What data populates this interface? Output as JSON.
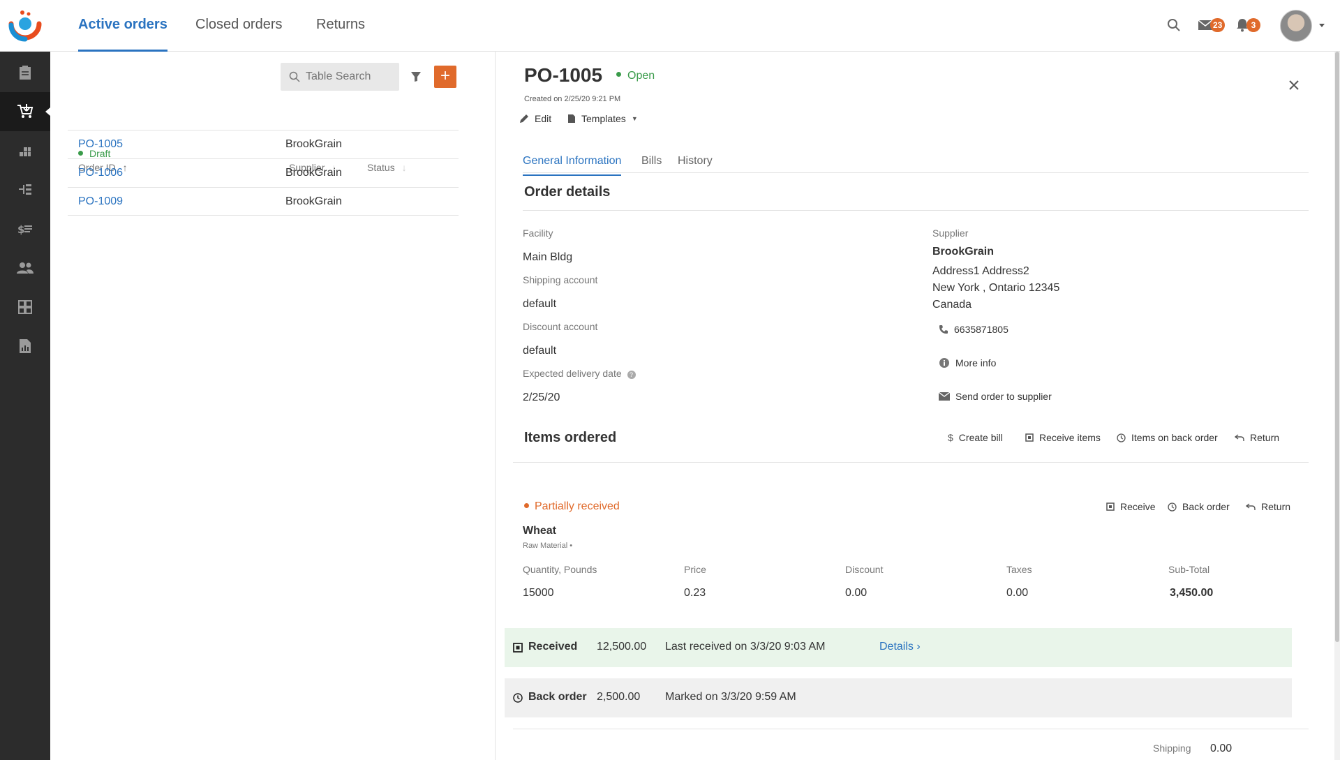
{
  "nav": {
    "tabs": [
      {
        "label": "Active orders"
      },
      {
        "label": "Closed orders"
      },
      {
        "label": "Returns"
      }
    ],
    "messages_count": "23",
    "notifications_count": "3"
  },
  "sidebar": {
    "items": [
      "clipboard-icon",
      "cart-icon",
      "inventory-icon",
      "process-icon",
      "price-list-icon",
      "people-icon",
      "dashboard-icon",
      "report-icon"
    ]
  },
  "list": {
    "search_placeholder": "Table Search",
    "add_label": "+",
    "legend": "Draft",
    "columns": {
      "order_id": "Order ID",
      "supplier": "Supplier",
      "status": "Status"
    },
    "rows": [
      {
        "id": "PO-1005",
        "supplier": "BrookGrain"
      },
      {
        "id": "PO-1006",
        "supplier": "BrookGrain"
      },
      {
        "id": "PO-1009",
        "supplier": "BrookGrain"
      }
    ]
  },
  "detail": {
    "title": "PO-1005",
    "status": "Open",
    "created": "Created on 2/25/20 9:21 PM",
    "actions": {
      "edit": "Edit",
      "templates": "Templates"
    },
    "tabs": [
      "General Information",
      "Bills",
      "History"
    ],
    "order_details_title": "Order details",
    "facility_label": "Facility",
    "facility": "Main Bldg",
    "shipping_account_label": "Shipping account",
    "shipping_account": "default",
    "discount_account_label": "Discount account",
    "discount_account": "default",
    "delivery_label": "Expected delivery date",
    "delivery": "2/25/20",
    "supplier_label": "Supplier",
    "supplier_name": "BrookGrain",
    "address1": "Address1 Address2",
    "address2": "New York , Ontario 12345",
    "address3": "Canada",
    "phone": "6635871805",
    "more_info": "More info",
    "send_order": "Send order to supplier",
    "items_title": "Items ordered",
    "items_actions": {
      "create_bill": "Create bill",
      "receive_items": "Receive items",
      "back_order": "Items on back order",
      "return": "Return"
    },
    "item": {
      "status": "Partially received",
      "actions": {
        "receive": "Receive",
        "back_order": "Back order",
        "return": "Return"
      },
      "name": "Wheat",
      "category": "Raw Material •",
      "cols": {
        "qty": "Quantity, Pounds",
        "price": "Price",
        "discount": "Discount",
        "taxes": "Taxes",
        "subtotal": "Sub-Total"
      },
      "qty": "15000",
      "price": "0.23",
      "discount": "0.00",
      "taxes": "0.00",
      "subtotal": "3,450.00"
    },
    "received": {
      "label": "Received",
      "qty": "12,500.00",
      "note": "Last received on 3/3/20 9:03 AM",
      "details": "Details ›"
    },
    "backorder": {
      "label": "Back order",
      "qty": "2,500.00",
      "note": "Marked on 3/3/20 9:59 AM"
    },
    "shipping_label": "Shipping",
    "shipping_value": "0.00"
  },
  "colors": {
    "accent": "#2a73c0",
    "orange": "#e06a2b",
    "green": "#3a9b4a",
    "sidebar": "#2c2c2c"
  }
}
